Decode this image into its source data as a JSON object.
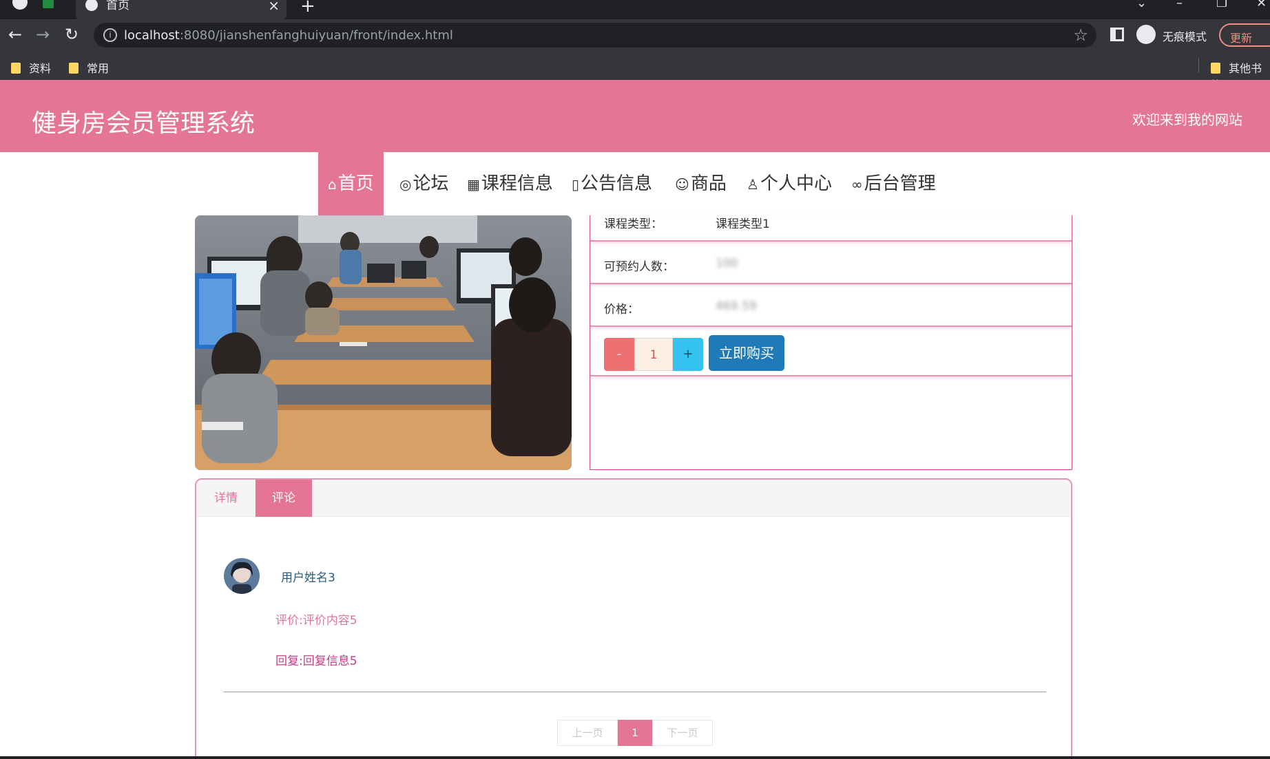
{
  "browser": {
    "tab_title": "首页",
    "new_tab_symbol": "+",
    "close_symbol": "×",
    "url_host": "localhost",
    "url_rest": ":8080/jianshenfanghuiyuan/front/index.html",
    "incognito_label": "无痕模式",
    "update_label": "更新",
    "bookmarks": [
      "资料",
      "常用",
      "其他书签"
    ]
  },
  "site": {
    "title": "健身房会员管理系统",
    "welcome": "欢迎来到我的网站"
  },
  "nav": {
    "items": [
      {
        "label": "首页",
        "icon": "home-icon",
        "glyph": "⌂",
        "active": true
      },
      {
        "label": "论坛",
        "icon": "palette-icon",
        "glyph": "◎",
        "active": false
      },
      {
        "label": "课程信息",
        "icon": "calendar-icon",
        "glyph": "▦",
        "active": false
      },
      {
        "label": "公告信息",
        "icon": "book-icon",
        "glyph": "▯",
        "active": false
      },
      {
        "label": "商品",
        "icon": "smile-icon",
        "glyph": "☺",
        "active": false
      },
      {
        "label": "个人中心",
        "icon": "user-icon",
        "glyph": "♙",
        "active": false
      },
      {
        "label": "后台管理",
        "icon": "link-icon",
        "glyph": "∞",
        "active": false
      }
    ]
  },
  "detail": {
    "course_type_label": "课程类型：",
    "course_type_value": "课程类型1",
    "capacity_label": "可预约人数：",
    "capacity_value": "100",
    "price_label": "价格：",
    "price_value": "469.59",
    "qty_minus": "-",
    "qty_value": "1",
    "qty_plus": "+",
    "buy_label": "立即购买"
  },
  "comments": {
    "tabs": [
      "详情",
      "评论"
    ],
    "active_tab": "评论",
    "items": [
      {
        "user": "用户姓名3",
        "evaluation": "评价:评价内容5",
        "reply": "回复:回复信息5"
      }
    ],
    "pager": {
      "prev": "上一页",
      "current": "1",
      "next": "下一页"
    }
  },
  "colors": {
    "brand": "#e57595",
    "buy_button": "#1f7ab8",
    "qty_minus": "#f06f72",
    "qty_plus": "#34c3ee"
  }
}
